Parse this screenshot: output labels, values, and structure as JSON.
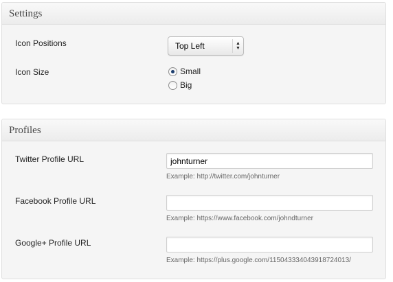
{
  "settings": {
    "title": "Settings",
    "icon_positions_label": "Icon Positions",
    "icon_positions_value": "Top Left",
    "icon_size_label": "Icon Size",
    "icon_size_options": [
      {
        "label": "Small",
        "checked": true
      },
      {
        "label": "Big",
        "checked": false
      }
    ]
  },
  "profiles": {
    "title": "Profiles",
    "twitter": {
      "label": "Twitter Profile URL",
      "value": "johnturner",
      "hint": "Example: http://twitter.com/johnturner"
    },
    "facebook": {
      "label": "Facebook Profile URL",
      "value": "",
      "hint": "Example: https://www.facebook.com/johndturner"
    },
    "google": {
      "label": "Google+ Profile URL",
      "value": "",
      "hint": "Example: https://plus.google.com/115043334043918724013/"
    }
  },
  "icons": {
    "select_arrows": "up-down-arrows-icon"
  }
}
